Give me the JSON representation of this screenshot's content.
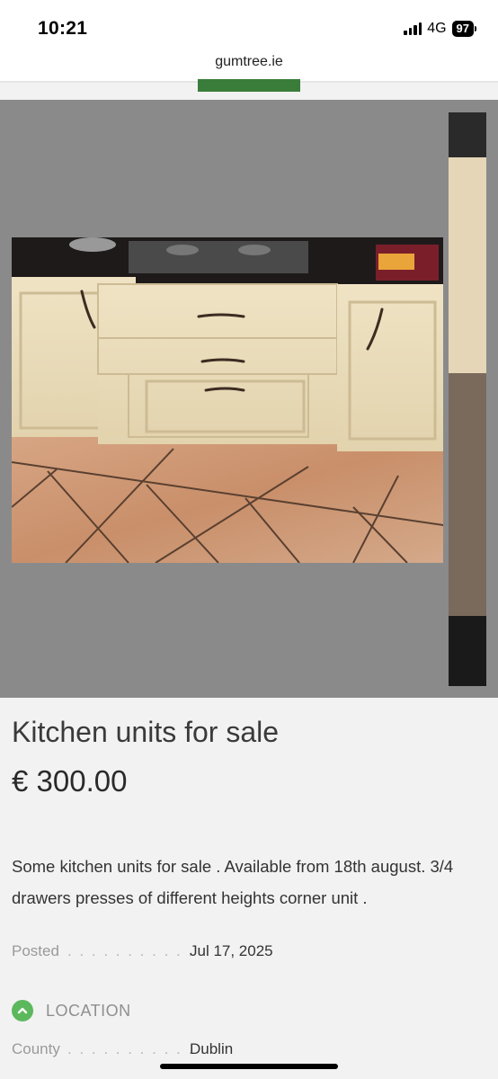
{
  "status_bar": {
    "time": "10:21",
    "network": "4G",
    "battery": "97"
  },
  "browser": {
    "url": "gumtree.ie"
  },
  "listing": {
    "title": "Kitchen units for sale",
    "price": "€ 300.00",
    "description": "Some kitchen units for sale . Available from 18th august. 3/4 drawers presses of different heights corner unit .",
    "posted_label": "Posted",
    "posted_value": "Jul 17, 2025",
    "location_header": "LOCATION",
    "county_label": "County",
    "county_value": "Dublin",
    "leader_dots": ". . . . . . . . . . . ."
  },
  "colors": {
    "accent_green": "#5cb85c",
    "cta_green": "#3a7d3a",
    "gallery_bg": "#8a8a8a",
    "page_bg": "#f2f2f2"
  },
  "icons": {
    "location_toggle": "chevron-up-icon",
    "signal": "signal-icon",
    "battery": "battery-icon"
  }
}
